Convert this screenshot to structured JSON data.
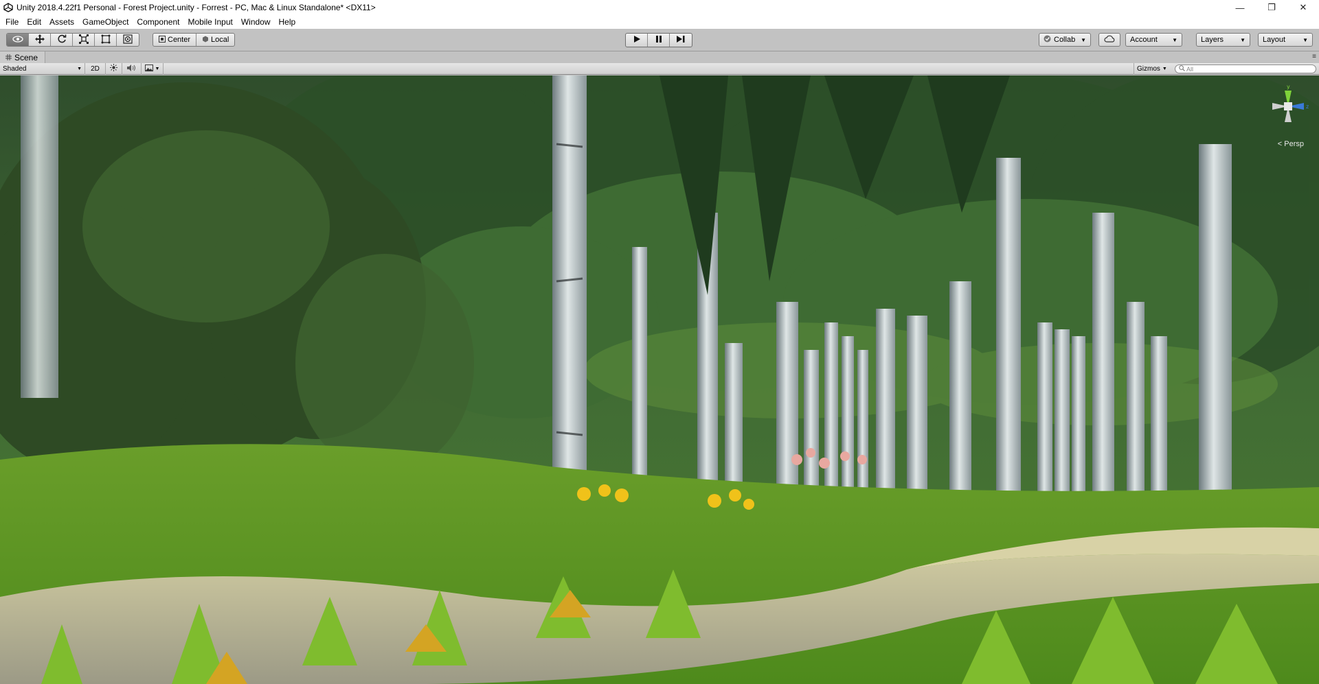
{
  "window": {
    "title": "Unity 2018.4.22f1 Personal - Forest Project.unity - Forrest - PC, Mac & Linux Standalone* <DX11>",
    "controls": {
      "minimize": "—",
      "maximize": "❐",
      "close": "✕"
    }
  },
  "menu": {
    "items": [
      "File",
      "Edit",
      "Assets",
      "GameObject",
      "Component",
      "Mobile Input",
      "Window",
      "Help"
    ]
  },
  "toolbar": {
    "tools": [
      {
        "name": "view-tool",
        "icon": "eye-icon",
        "glyph": "👁"
      },
      {
        "name": "move-tool",
        "icon": "move-icon",
        "glyph": "✥"
      },
      {
        "name": "rotate-tool",
        "icon": "rotate-icon",
        "glyph": "⟳"
      },
      {
        "name": "scale-tool",
        "icon": "scale-icon",
        "glyph": "⤡"
      },
      {
        "name": "rect-tool",
        "icon": "rect-icon",
        "glyph": "▣"
      },
      {
        "name": "transform-tool",
        "icon": "transform-icon",
        "glyph": "◎"
      }
    ],
    "pivot": {
      "center_label": "Center",
      "local_label": "Local"
    },
    "play": {
      "play": "▶",
      "pause": "❚❚",
      "step": "▶❙"
    },
    "collab_label": "Collab",
    "account_label": "Account",
    "layers_label": "Layers",
    "layout_label": "Layout"
  },
  "scene_tab": {
    "label": "Scene"
  },
  "scene_toolbar": {
    "shading_mode": "Shaded",
    "mode_2d": "2D",
    "gizmos_label": "Gizmos",
    "search_placeholder": "All"
  },
  "scene_view": {
    "projection_label": "< Persp"
  },
  "colors": {
    "toolbar_bg": "#c2c2c2",
    "active_tool": "#7a7a7a",
    "gizmo_x": "#d83a3a",
    "gizmo_y": "#7fd33a",
    "gizmo_z": "#3a7ad8"
  }
}
